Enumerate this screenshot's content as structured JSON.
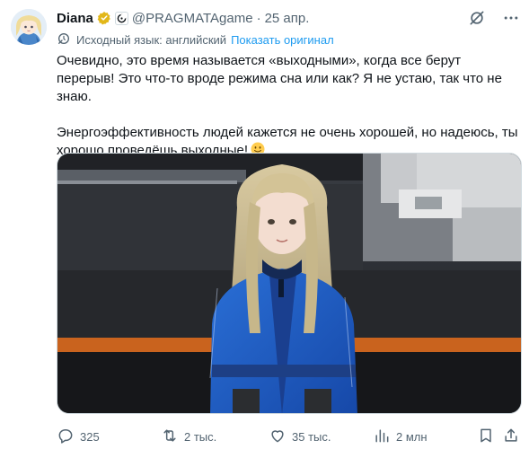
{
  "tweet": {
    "author_name": "Diana",
    "handle": "@PRAGMATAgame",
    "separator": "·",
    "date": "25 апр.",
    "translation": {
      "source_label": "Исходный язык: английский",
      "show_original": "Показать оригинал"
    },
    "paragraphs": [
      "Очевидно, это время называется «выходными», когда все берут перерыв! Это что-то вроде режима сна или как? Я не устаю, так что не знаю.",
      "Энергоэффективность людей кажется не очень хорошей, но надеюсь, ты хорошо проведёшь выходные!"
    ],
    "icons": {
      "verified": "verified-gold-badge-icon",
      "affiliate": "pragmata-logo-icon",
      "grok": "grok-icon",
      "more": "more-icon",
      "translate": "translate-icon",
      "emoji": "slightly-smiling-face-emoji"
    }
  },
  "actions": {
    "replies": "325",
    "reposts": "2 тыс.",
    "likes": "35 тыс.",
    "views": "2 млн"
  },
  "colors": {
    "accent": "#1d9bf0",
    "secondary_text": "#536471",
    "text": "#0f1419",
    "verified": "#e2b719"
  }
}
